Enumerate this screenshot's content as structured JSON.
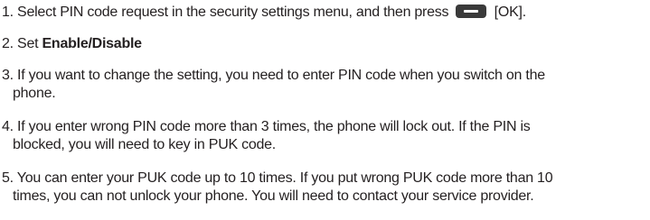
{
  "steps": [
    {
      "num": "1.",
      "text_before": " Select PIN code request in the security settings menu, and then press ",
      "text_after": " [OK]."
    },
    {
      "num": "2.",
      "text_before": " Set ",
      "bold": "Enable/Disable"
    },
    {
      "num": "3.",
      "line1": " If you want to change the setting, you need to enter PIN code when you switch on the",
      "line2": "phone."
    },
    {
      "num": "4.",
      "line1": " If you enter wrong PIN code more than 3 times, the phone will lock out. If the PIN is",
      "line2": "blocked, you will need to key in PUK code."
    },
    {
      "num": "5.",
      "line1": " You can enter your PUK code up to 10 times. If you put wrong PUK code more than 10",
      "line2": "times, you can not unlock your phone. You will need to contact your service provider."
    }
  ],
  "icons": {
    "ok_key": "ok-softkey-icon"
  },
  "colors": {
    "text": "#231f20",
    "key": "#3a3a3a"
  }
}
